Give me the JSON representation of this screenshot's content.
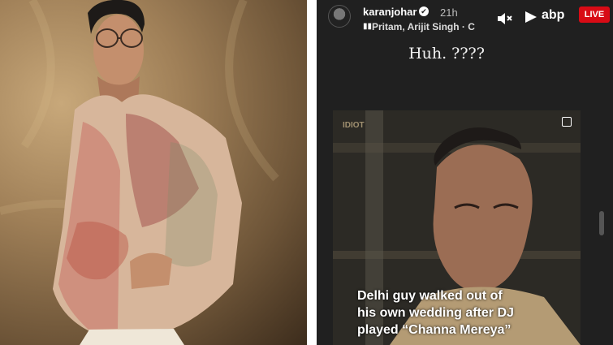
{
  "header": {
    "username": "karanjohar",
    "verified_glyph": "✔",
    "time": "21h",
    "music_icon": "music-bars-icon",
    "music_label": "Pritam, Arijit Singh · C"
  },
  "logo": {
    "text": "abp"
  },
  "live_badge": {
    "label": "LIVE",
    "color": "#d80b15"
  },
  "story": {
    "caption": "Huh. ????",
    "clip_watermark": "IDIOT",
    "overlay_lines": [
      "Delhi guy walked out of",
      "his own wedding after DJ",
      "played “Channa Mereya”"
    ]
  }
}
